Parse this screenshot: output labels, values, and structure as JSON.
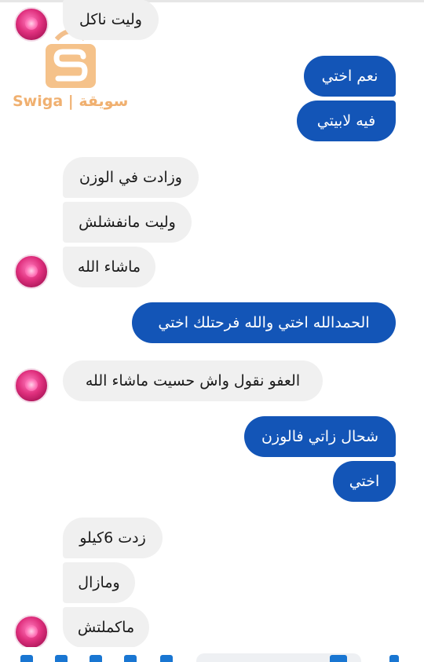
{
  "watermark": {
    "text": "Swiga | سويقة",
    "color": "#f0b070"
  },
  "colors": {
    "incoming_bg": "#f0f0f0",
    "outgoing_bg": "#1355b7"
  },
  "messages": [
    {
      "dir": "in",
      "text": "وليت ناكل"
    },
    {
      "dir": "out",
      "text": "نعم اختي"
    },
    {
      "dir": "out",
      "text": "فيه لابيتي"
    },
    {
      "dir": "in",
      "text": "وزادت في الوزن"
    },
    {
      "dir": "in",
      "text": "وليت مانفشلش"
    },
    {
      "dir": "in",
      "text": "ماشاء الله"
    },
    {
      "dir": "out",
      "text": "الحمدالله اختي والله فرحتلك اختي"
    },
    {
      "dir": "in",
      "text": "العفو  نقول واش حسيت ماشاء الله"
    },
    {
      "dir": "out",
      "text": "شحال زاتي فالوزن"
    },
    {
      "dir": "out",
      "text": "اختي"
    },
    {
      "dir": "in",
      "text": "زدت 6كيلو"
    },
    {
      "dir": "in",
      "text": "ومازال"
    },
    {
      "dir": "in",
      "text": "ماكملتش"
    }
  ],
  "bottom_bar": {
    "icons": [
      "camera-icon",
      "image-icon",
      "microphone-icon",
      "emoji-icon",
      "like-icon"
    ]
  }
}
